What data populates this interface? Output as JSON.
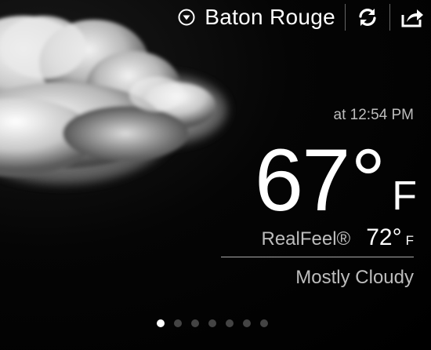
{
  "header": {
    "city": "Baton Rouge",
    "dropdown_icon": "chevron-down-circle-icon",
    "refresh_icon": "refresh-icon",
    "share_icon": "share-icon"
  },
  "weather": {
    "updated_time": "at 12:54 PM",
    "temperature": "67",
    "degree_symbol": "°",
    "unit": "F",
    "realfeel_label": "RealFeel®",
    "realfeel_value": "72",
    "realfeel_unit": "F",
    "condition": "Mostly Cloudy",
    "condition_icon": "cloud-icon"
  },
  "pager": {
    "total_pages": 7,
    "active_index": 0
  },
  "colors": {
    "background": "#000000",
    "primary_text": "#ffffff",
    "secondary_text": "#bdbdbd",
    "inactive_dot": "#444444",
    "active_dot": "#ffffff"
  }
}
